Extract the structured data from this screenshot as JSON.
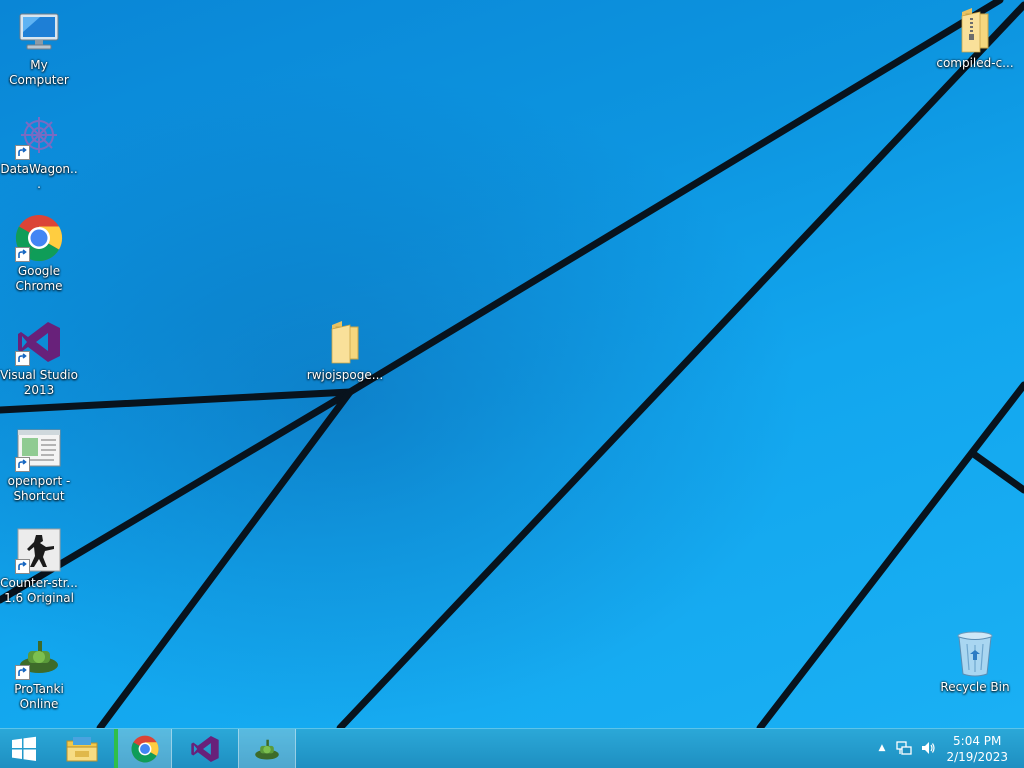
{
  "desktop": {
    "icons": [
      {
        "label": "My Computer"
      },
      {
        "label": "DataWagon..."
      },
      {
        "label": "Google Chrome"
      },
      {
        "label": "Visual Studio 2013"
      },
      {
        "label": "openport - Shortcut"
      },
      {
        "label": "Counter-str... 1.6 Original"
      },
      {
        "label": "ProTanki Online"
      },
      {
        "label": "rwjojspoge..."
      },
      {
        "label": "compiled-c..."
      },
      {
        "label": "Recycle Bin"
      }
    ]
  },
  "taskbar": {
    "start_icon": "windows-logo-icon",
    "pinned": [
      {
        "name": "file-explorer-icon"
      },
      {
        "name": "chrome-icon"
      },
      {
        "name": "visual-studio-icon"
      },
      {
        "name": "protanki-icon"
      }
    ],
    "tray": {
      "show_hidden": "▲",
      "network_icon": "network-icon",
      "volume_icon": "volume-icon"
    },
    "clock": {
      "time": "5:04 PM",
      "date": "2/19/2023"
    }
  },
  "colors": {
    "wallpaper": "#0d95e0",
    "taskbar": "#2ba8d8"
  }
}
